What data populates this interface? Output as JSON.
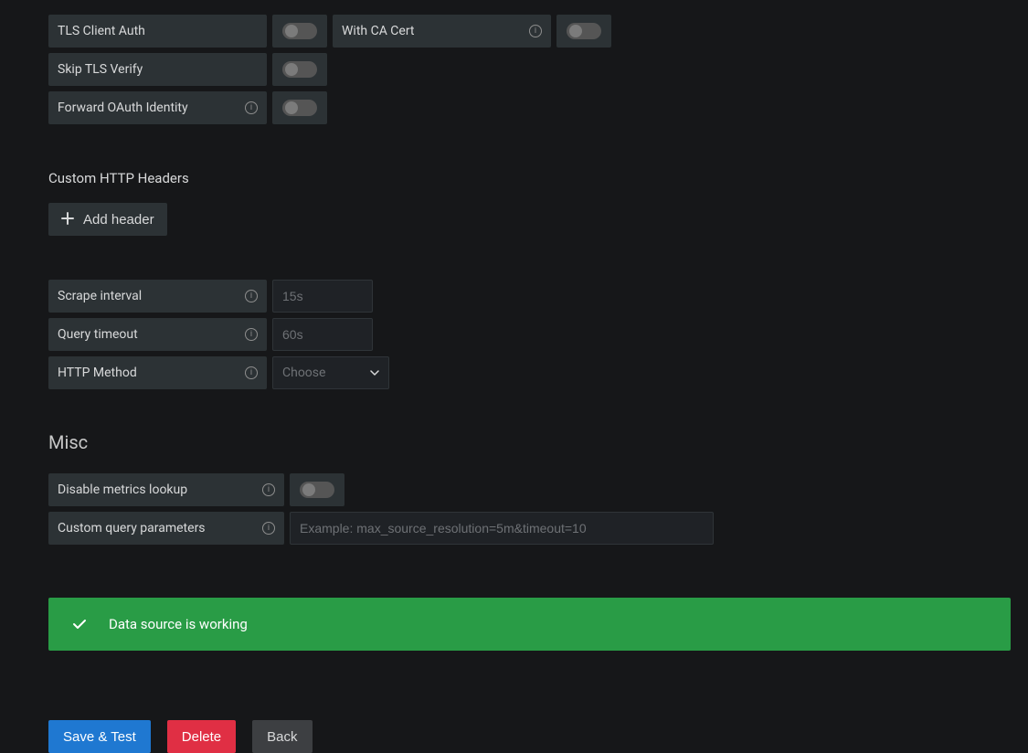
{
  "auth": {
    "tls_client_auth": {
      "label": "TLS Client Auth",
      "value": false
    },
    "with_ca_cert": {
      "label": "With CA Cert",
      "value": false
    },
    "skip_tls_verify": {
      "label": "Skip TLS Verify",
      "value": false
    },
    "forward_oauth": {
      "label": "Forward OAuth Identity",
      "value": false
    }
  },
  "custom_headers": {
    "title": "Custom HTTP Headers",
    "add_label": "Add header"
  },
  "scrape": {
    "interval_label": "Scrape interval",
    "interval_placeholder": "15s",
    "timeout_label": "Query timeout",
    "timeout_placeholder": "60s",
    "method_label": "HTTP Method",
    "method_placeholder": "Choose"
  },
  "misc": {
    "title": "Misc",
    "disable_lookup_label": "Disable metrics lookup",
    "disable_lookup_value": false,
    "custom_query_label": "Custom query parameters",
    "custom_query_placeholder": "Example: max_source_resolution=5m&timeout=10"
  },
  "alert": {
    "message": "Data source is working"
  },
  "buttons": {
    "save_test": "Save & Test",
    "delete": "Delete",
    "back": "Back"
  }
}
